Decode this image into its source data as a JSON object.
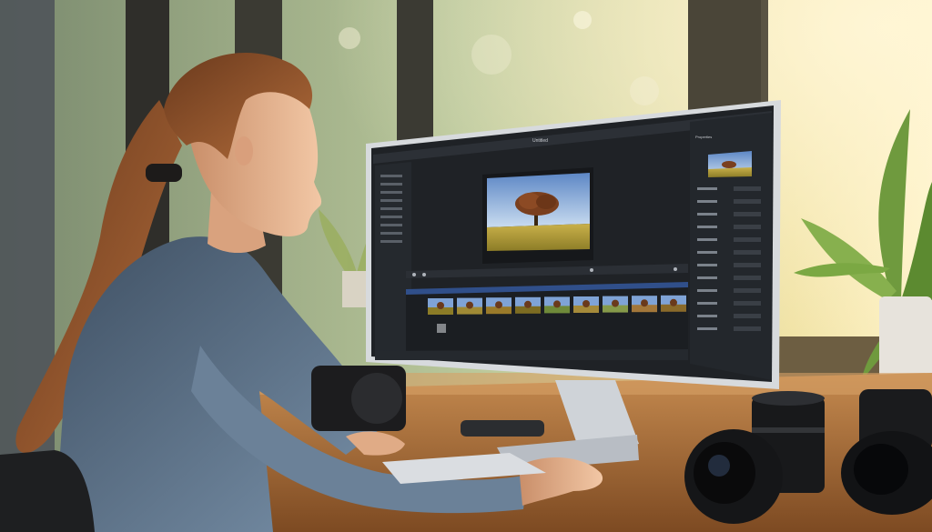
{
  "scene": {
    "palette": {
      "window_light": "#e9d9a4",
      "foliage": "#6f8f4a",
      "frame": "#3b3a33",
      "desk": "#a9713e",
      "skin": "#e8b896",
      "hair": "#8a4f2a",
      "denim": "#5d7389",
      "monitor_bezel": "#d7dadd",
      "screen_bg": "#1f2226",
      "accent": "#3f6fd1"
    }
  },
  "editor": {
    "title": "Untitled",
    "panel_title": "Properties",
    "preview_subject": "tree-in-field",
    "timeline_clip_count": 9,
    "sidebar_rows": 9,
    "properties_rows": 12
  }
}
